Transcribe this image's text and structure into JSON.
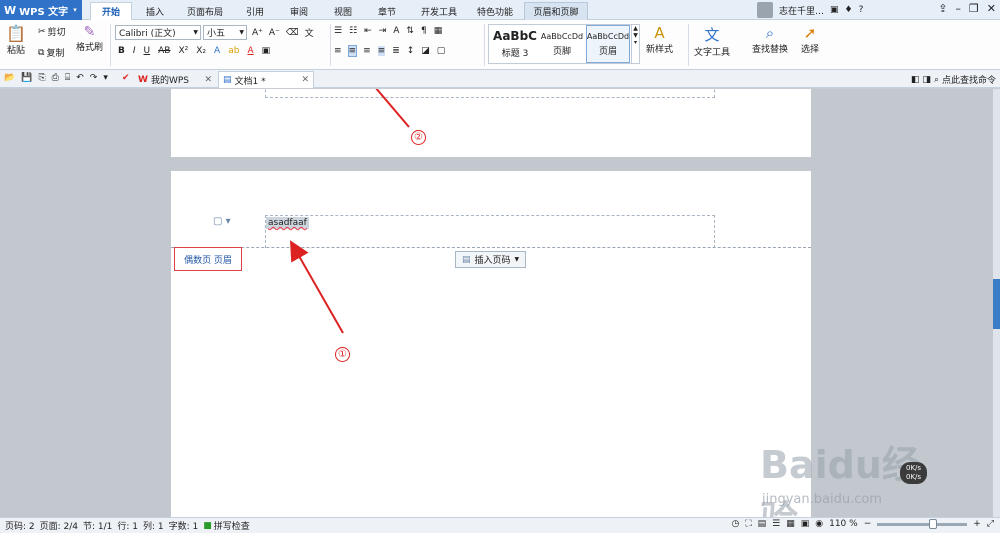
{
  "app": {
    "name": "WPS 文字"
  },
  "menu_tabs": [
    "开始",
    "插入",
    "页面布局",
    "引用",
    "审阅",
    "视图",
    "章节",
    "开发工具",
    "特色功能",
    "页眉和页脚"
  ],
  "user": {
    "name": "志在千里…"
  },
  "ribbon": {
    "paste": "粘贴",
    "cut": "剪切",
    "copy": "复制",
    "format_painter": "格式刷",
    "font_name": "Calibri (正文)",
    "font_size": "小五",
    "styles": [
      {
        "preview": "AaBbC",
        "name": "标题 3"
      },
      {
        "preview": "AaBbCcDd",
        "name": "页脚"
      },
      {
        "preview": "AaBbCcDd",
        "name": "页眉"
      }
    ],
    "new_style": "新样式",
    "text_tools": "文字工具",
    "find_replace": "查找替换",
    "select": "选择"
  },
  "doc_tabs": [
    "我的WPS",
    "文档1 *"
  ],
  "search_cmd": "点此查找命令",
  "document": {
    "header_text": "asadfaaf",
    "header_label": "偶数页 页眉",
    "insert_page_number": "插入页码",
    "annotation_1": "①",
    "annotation_2": "②"
  },
  "status": {
    "page_num": "页码: 2",
    "pages": "页面: 2/4",
    "section": "节: 1/1",
    "row": "行: 1",
    "col": "列: 1",
    "words": "字数: 1",
    "spell": "拼写检查",
    "zoom": "110 %"
  },
  "watermark": {
    "brand": "Baidu经验",
    "domain": "jingyan.baidu.com"
  },
  "net_speed": {
    "up": "0K/s",
    "down": "0K/s"
  },
  "colors": {
    "accent": "#2f72c8",
    "annotation": "#d22222"
  }
}
